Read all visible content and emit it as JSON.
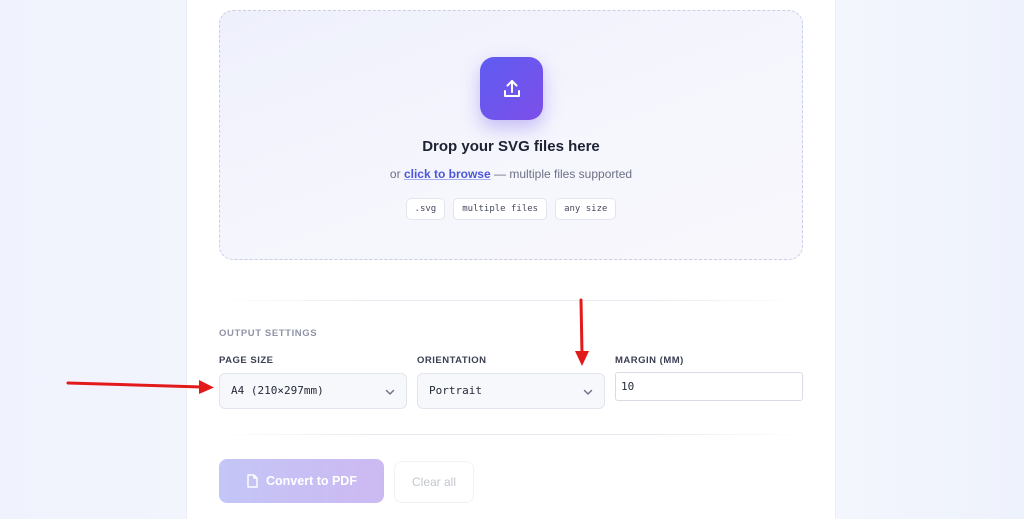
{
  "dropzone": {
    "title": "Drop your SVG files here",
    "sub_prefix": "or",
    "browse_link": "click to browse",
    "sub_suffix": "— multiple files supported",
    "chips": [
      ".svg",
      "multiple files",
      "any size"
    ],
    "icon": "upload-icon"
  },
  "settings": {
    "section_label": "OUTPUT SETTINGS",
    "page_size": {
      "label": "PAGE SIZE",
      "value": "A4 (210×297mm)"
    },
    "orientation": {
      "label": "ORIENTATION",
      "value": "Portrait"
    },
    "margin": {
      "label": "MARGIN (MM)",
      "value": "10"
    }
  },
  "actions": {
    "convert_label": "Convert to PDF",
    "convert_icon": "file-icon",
    "clear_label": "Clear all"
  },
  "colors": {
    "accent": "#5f5cf2",
    "annotation_arrow": "#e21a1a"
  }
}
